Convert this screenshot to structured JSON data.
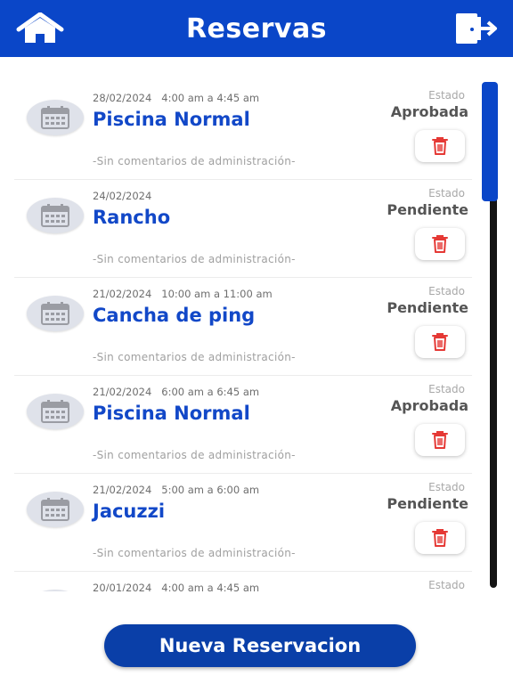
{
  "header": {
    "title": "Reservas",
    "home_icon": "home-icon",
    "logout_icon": "logout-icon",
    "color": "#0a46c8"
  },
  "reservations": [
    {
      "datetime": "28/02/2024   4:00 am a 4:45 am",
      "name": "Piscina Normal",
      "status_label": "Estado",
      "status": "Aprobada",
      "comment": "-Sin comentarios de administración-"
    },
    {
      "datetime": "24/02/2024",
      "name": "Rancho",
      "status_label": "Estado",
      "status": "Pendiente",
      "comment": "-Sin comentarios de administración-"
    },
    {
      "datetime": "21/02/2024   10:00 am a 11:00 am",
      "name": "Cancha de ping",
      "status_label": "Estado",
      "status": "Pendiente",
      "comment": "-Sin comentarios de administración-"
    },
    {
      "datetime": "21/02/2024   6:00 am a 6:45 am",
      "name": "Piscina Normal",
      "status_label": "Estado",
      "status": "Aprobada",
      "comment": "-Sin comentarios de administración-"
    },
    {
      "datetime": "21/02/2024   5:00 am a 6:00 am",
      "name": "Jacuzzi",
      "status_label": "Estado",
      "status": "Pendiente",
      "comment": "-Sin comentarios de administración-"
    },
    {
      "datetime": "20/01/2024   4:00 am a 4:45 am",
      "name": "",
      "status_label": "Estado",
      "status": "",
      "comment": ""
    }
  ],
  "icons": {
    "card_icon": "calendar-icon",
    "delete_icon": "trash-icon",
    "delete_color": "#e53935"
  },
  "footer": {
    "new_button_label": "Nueva Reservacion",
    "color": "#0a3fa8"
  }
}
